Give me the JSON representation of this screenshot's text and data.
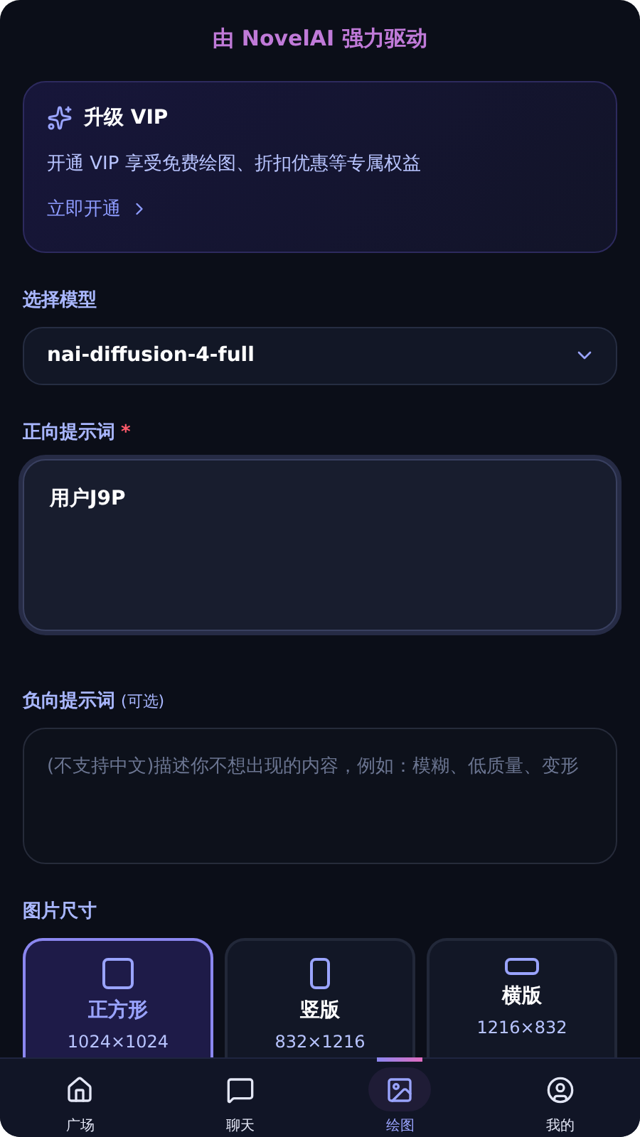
{
  "header": {
    "title": "由 NovelAI 强力驱动"
  },
  "vip_card": {
    "title": "升级 VIP",
    "description": "开通 VIP 享受免费绘图、折扣优惠等专属权益",
    "link": "立即开通"
  },
  "model": {
    "label": "选择模型",
    "value": "nai-diffusion-4-full"
  },
  "positive_prompt": {
    "label": "正向提示词",
    "required_mark": "*",
    "value": "用户J9P"
  },
  "negative_prompt": {
    "label": "负向提示词",
    "hint": "(可选)",
    "placeholder": "(不支持中文)描述你不想出现的内容，例如：模糊、低质量、变形"
  },
  "image_size": {
    "label": "图片尺寸",
    "options": [
      {
        "kind": "square",
        "name": "正方形",
        "size": "1024×1024",
        "selected": true
      },
      {
        "kind": "portrait",
        "name": "竖版",
        "size": "832×1216",
        "selected": false
      },
      {
        "kind": "landscape",
        "name": "横版",
        "size": "1216×832",
        "selected": false
      }
    ]
  },
  "bottom_nav": [
    {
      "kind": "home",
      "label": "广场",
      "selected": false
    },
    {
      "kind": "chat",
      "label": "聊天",
      "selected": false
    },
    {
      "kind": "image",
      "label": "绘图",
      "selected": true
    },
    {
      "kind": "user",
      "label": "我的",
      "selected": false
    }
  ]
}
